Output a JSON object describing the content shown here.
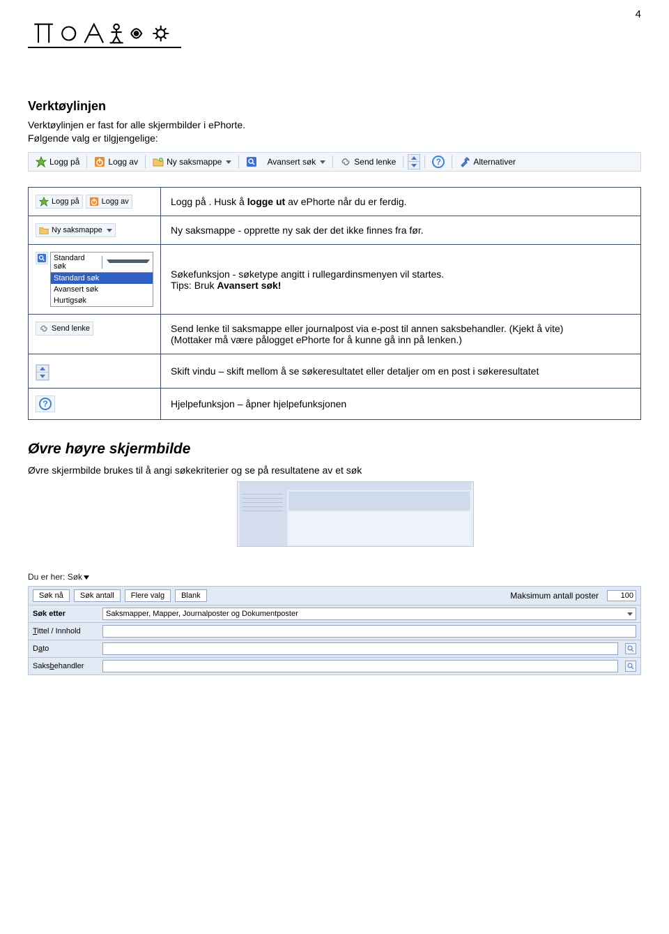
{
  "page_number": "4",
  "section1": {
    "title": "Verktøylinjen",
    "p1": "Verktøylinjen er fast for alle skjermbilder i ePhorte.",
    "p2": "Følgende valg er tilgjengelige:"
  },
  "toolbar": {
    "logg_pa": "Logg på",
    "logg_av": "Logg av",
    "ny_saksmappe": "Ny saksmappe",
    "avansert_sok": "Avansert søk",
    "send_lenke": "Send lenke",
    "alternativer": "Alternativer"
  },
  "rows": [
    {
      "text_pre": "Logg på . Husk å ",
      "text_bold": "logge ut",
      "text_post": " av ePhorte når du er ferdig."
    },
    {
      "text_pre": "Ny saksmappe - opprette ny sak der det ikke finnes fra før.",
      "text_bold": "",
      "text_post": ""
    },
    {
      "text_pre": "Søkefunksjon - søketype angitt i rullegardinsmenyen vil startes.",
      "text_bold": "Avansert søk!",
      "tip": "Tips: Bruk "
    },
    {
      "text_pre": "Send lenke til saksmappe eller journalpost via e-post til annen saksbehandler. (Kjekt å vite)",
      "text_post": "(Mottaker må være pålogget ePhorte for å kunne gå inn på lenken.)"
    },
    {
      "text_pre": "Skift vindu – skift mellom å se søkeresultatet eller detaljer om en post i søkeresultatet"
    },
    {
      "text_pre": "Hjelpefunksjon – åpner hjelpefunksjonen"
    }
  ],
  "search_dd": {
    "label": "Standard søk",
    "options": [
      "Standard søk",
      "Avansert søk",
      "Hurtigsøk"
    ]
  },
  "mini": {
    "logg_pa": "Logg på",
    "logg_av": "Logg av",
    "ny_saksmappe": "Ny saksmappe",
    "send_lenke": "Send lenke"
  },
  "section2": {
    "title": "Øvre høyre skjermbilde",
    "p1": "Øvre skjermbilde brukes til å angi søkekriterier og se på resultatene av et søk"
  },
  "search_panel": {
    "breadcrumb": "Du er her: Søk",
    "sok_na": "Søk nå",
    "sok_antall": "Søk antall",
    "flere_valg": "Flere valg",
    "blank": "Blank",
    "maks_label": "Maksimum antall poster",
    "maks_value": "100",
    "sok_etter_lbl": "Søk etter",
    "sok_etter_val": "Saksmapper, Mapper, Journalposter og Dokumentposter",
    "tittel_lbl_u": "T",
    "tittel_lbl": "ittel / Innhold",
    "dato_lbl_u": "a",
    "dato_pre": "D",
    "dato_post": "to",
    "saksb_lbl_u": "b",
    "saksb_pre": "Saks",
    "saksb_post": "ehandler"
  }
}
